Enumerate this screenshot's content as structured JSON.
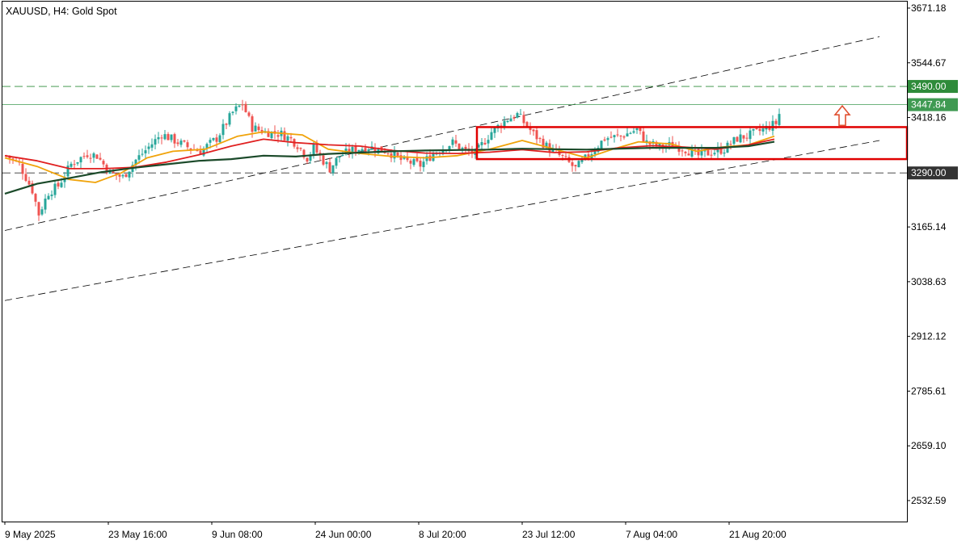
{
  "header": {
    "title": "XAUUSD, H4:  Gold Spot"
  },
  "colors": {
    "bull_candle": "#26a69a",
    "bear_candle": "#ef5350",
    "ma_fast": "#f0a30a",
    "ma_mid": "#e02020",
    "ma_slow": "#1b4a2a",
    "level_line": "#2e8b3a",
    "price_line": "#3f9a52",
    "price_badge": "#2e8b3a",
    "box": "#e00000",
    "trend_line": "#000000",
    "arrow": "#e05030"
  },
  "chart_data": {
    "type": "candlestick",
    "symbol": "XAUUSD",
    "timeframe": "H4",
    "title": "XAUUSD, H4:  Gold Spot",
    "x_tick_labels": [
      "9 May 2025",
      "23 May 16:00",
      "9 Jun 08:00",
      "24 Jun 00:00",
      "8 Jul 20:00",
      "23 Jul 12:00",
      "7 Aug 04:00",
      "21 Aug 20:00"
    ],
    "y_tick_labels": [
      "3671.18",
      "3544.67",
      "3418.16",
      "3165.14",
      "3038.63",
      "2912.12",
      "2785.61",
      "2659.10",
      "2532.59"
    ],
    "ylim": [
      2420,
      3690
    ],
    "grid": false,
    "price_levels": [
      {
        "label": "3490.00",
        "value": 3490.0,
        "style": "dashed"
      },
      {
        "label": "3290.00",
        "value": 3290.0,
        "style": "dashed"
      }
    ],
    "current_price": {
      "label": "3447.84",
      "value": 3447.84
    },
    "price_path": [
      [
        0,
        3330
      ],
      [
        4,
        3310
      ],
      [
        8,
        3250
      ],
      [
        10,
        3195
      ],
      [
        13,
        3245
      ],
      [
        16,
        3260
      ],
      [
        20,
        3310
      ],
      [
        25,
        3335
      ],
      [
        28,
        3330
      ],
      [
        32,
        3290
      ],
      [
        36,
        3280
      ],
      [
        40,
        3320
      ],
      [
        44,
        3350
      ],
      [
        48,
        3380
      ],
      [
        52,
        3365
      ],
      [
        56,
        3350
      ],
      [
        60,
        3340
      ],
      [
        65,
        3370
      ],
      [
        70,
        3430
      ],
      [
        73,
        3450
      ],
      [
        76,
        3395
      ],
      [
        80,
        3385
      ],
      [
        85,
        3380
      ],
      [
        88,
        3368
      ],
      [
        90,
        3355
      ],
      [
        93,
        3325
      ],
      [
        95,
        3348
      ],
      [
        98,
        3318
      ],
      [
        100,
        3300
      ],
      [
        103,
        3330
      ],
      [
        108,
        3345
      ],
      [
        112,
        3350
      ],
      [
        118,
        3340
      ],
      [
        122,
        3320
      ],
      [
        128,
        3308
      ],
      [
        132,
        3335
      ],
      [
        138,
        3360
      ],
      [
        142,
        3340
      ],
      [
        145,
        3335
      ],
      [
        150,
        3385
      ],
      [
        155,
        3415
      ],
      [
        158,
        3425
      ],
      [
        163,
        3380
      ],
      [
        168,
        3345
      ],
      [
        172,
        3325
      ],
      [
        176,
        3300
      ],
      [
        180,
        3330
      ],
      [
        185,
        3370
      ],
      [
        190,
        3375
      ],
      [
        195,
        3390
      ],
      [
        198,
        3360
      ],
      [
        202,
        3350
      ],
      [
        206,
        3355
      ],
      [
        210,
        3345
      ],
      [
        214,
        3330
      ],
      [
        218,
        3338
      ],
      [
        222,
        3345
      ],
      [
        226,
        3370
      ],
      [
        230,
        3378
      ],
      [
        234,
        3390
      ],
      [
        238,
        3405
      ],
      [
        240,
        3447.84
      ]
    ],
    "series": [
      {
        "kind": "moving_average",
        "color_key": "ma_fast",
        "points": [
          [
            0,
            3325
          ],
          [
            10,
            3305
          ],
          [
            20,
            3275
          ],
          [
            28,
            3268
          ],
          [
            36,
            3290
          ],
          [
            44,
            3325
          ],
          [
            52,
            3340
          ],
          [
            62,
            3345
          ],
          [
            72,
            3375
          ],
          [
            80,
            3385
          ],
          [
            92,
            3378
          ],
          [
            100,
            3345
          ],
          [
            110,
            3335
          ],
          [
            120,
            3328
          ],
          [
            130,
            3325
          ],
          [
            140,
            3330
          ],
          [
            150,
            3345
          ],
          [
            160,
            3365
          ],
          [
            170,
            3345
          ],
          [
            180,
            3325
          ],
          [
            188,
            3345
          ],
          [
            196,
            3362
          ],
          [
            206,
            3357
          ],
          [
            214,
            3340
          ],
          [
            222,
            3350
          ],
          [
            230,
            3355
          ],
          [
            238,
            3375
          ]
        ]
      },
      {
        "kind": "moving_average",
        "color_key": "ma_mid",
        "points": [
          [
            0,
            3330
          ],
          [
            10,
            3318
          ],
          [
            20,
            3300
          ],
          [
            30,
            3300
          ],
          [
            40,
            3303
          ],
          [
            50,
            3315
          ],
          [
            60,
            3332
          ],
          [
            70,
            3352
          ],
          [
            80,
            3368
          ],
          [
            90,
            3360
          ],
          [
            100,
            3355
          ],
          [
            110,
            3352
          ],
          [
            120,
            3342
          ],
          [
            130,
            3336
          ],
          [
            140,
            3335
          ],
          [
            150,
            3338
          ],
          [
            160,
            3344
          ],
          [
            170,
            3337
          ],
          [
            180,
            3339
          ],
          [
            190,
            3348
          ],
          [
            200,
            3353
          ],
          [
            210,
            3350
          ],
          [
            220,
            3345
          ],
          [
            230,
            3355
          ],
          [
            238,
            3368
          ]
        ]
      },
      {
        "kind": "moving_average",
        "color_key": "ma_slow",
        "points": [
          [
            0,
            3242
          ],
          [
            10,
            3265
          ],
          [
            20,
            3278
          ],
          [
            30,
            3292
          ],
          [
            40,
            3302
          ],
          [
            50,
            3310
          ],
          [
            60,
            3318
          ],
          [
            70,
            3322
          ],
          [
            80,
            3330
          ],
          [
            90,
            3328
          ],
          [
            100,
            3334
          ],
          [
            110,
            3337
          ],
          [
            120,
            3340
          ],
          [
            130,
            3342
          ],
          [
            140,
            3343
          ],
          [
            150,
            3344
          ],
          [
            160,
            3346
          ],
          [
            170,
            3345
          ],
          [
            180,
            3344
          ],
          [
            190,
            3346
          ],
          [
            200,
            3348
          ],
          [
            210,
            3348
          ],
          [
            220,
            3348
          ],
          [
            230,
            3352
          ],
          [
            238,
            3362
          ]
        ]
      }
    ],
    "trend_lines": [
      {
        "from": [
          0,
          3157
        ],
        "to": [
          270,
          3605
        ]
      },
      {
        "from": [
          0,
          2995
        ],
        "to": [
          270,
          3365
        ]
      }
    ],
    "box": {
      "x_from": 146,
      "x_to": 279,
      "y_from": 3322,
      "y_to": 3396
    },
    "arrow": {
      "x": 259,
      "y_from": 3400,
      "y_to": 3445,
      "direction": "up"
    },
    "candle_count": 240
  }
}
